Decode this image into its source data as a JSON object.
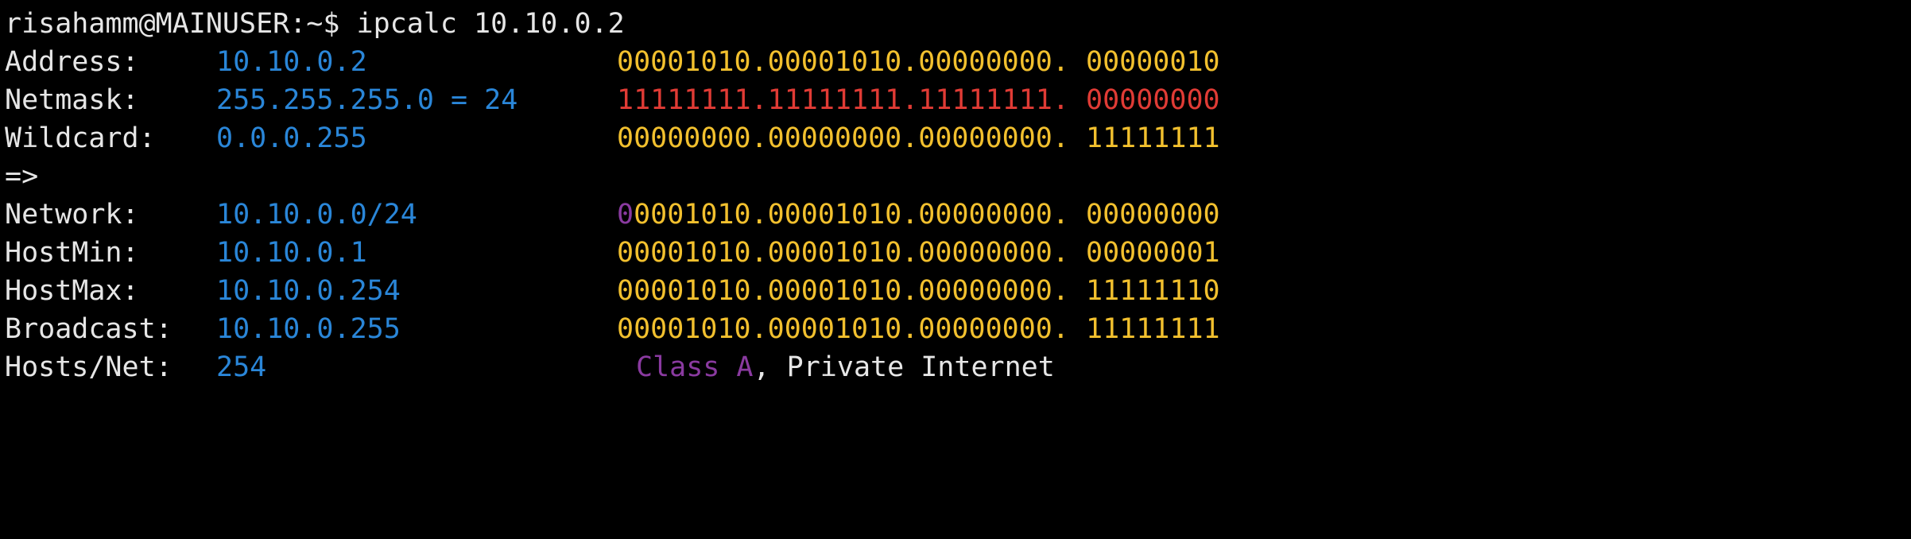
{
  "terminal": {
    "prompt": "risahamm@MAINUSER:~$ ",
    "command": "ipcalc 10.10.0.2",
    "rows": [
      {
        "label": "Address:",
        "value": "10.10.0.2",
        "bin_main": "00001010.00001010.00000000.",
        "bin_tail": " 00000010"
      },
      {
        "label": "Netmask:",
        "value": "255.255.255.0 = 24",
        "bin_main": "11111111.11111111.11111111.",
        "bin_tail": " 00000000"
      },
      {
        "label": "Wildcard:",
        "value": "0.0.0.255",
        "bin_main": "00000000.00000000.00000000.",
        "bin_tail": " 11111111"
      },
      {
        "label": "=>"
      },
      {
        "label": "Network:",
        "value": "10.10.0.0/24",
        "bin_lead": "0",
        "bin_main": "0001010.00001010.00000000.",
        "bin_tail": " 00000000"
      },
      {
        "label": "HostMin:",
        "value": "10.10.0.1",
        "bin_main": "00001010.00001010.00000000.",
        "bin_tail": " 00000001"
      },
      {
        "label": "HostMax:",
        "value": "10.10.0.254",
        "bin_main": "00001010.00001010.00000000.",
        "bin_tail": " 11111110"
      },
      {
        "label": "Broadcast:",
        "value": "10.10.0.255",
        "bin_main": "00001010.00001010.00000000.",
        "bin_tail": " 11111111"
      },
      {
        "label": "Hosts/Net:",
        "value": "254",
        "class_text": "Class A",
        "info_text": ", Private Internet"
      }
    ]
  },
  "colors": {
    "background": "#000000",
    "text": "#e6e6e6",
    "value_blue": "#2a86d8",
    "binary_yellow": "#f2c02e",
    "mask_red": "#e03b35",
    "class_purple": "#8a3aa0"
  }
}
